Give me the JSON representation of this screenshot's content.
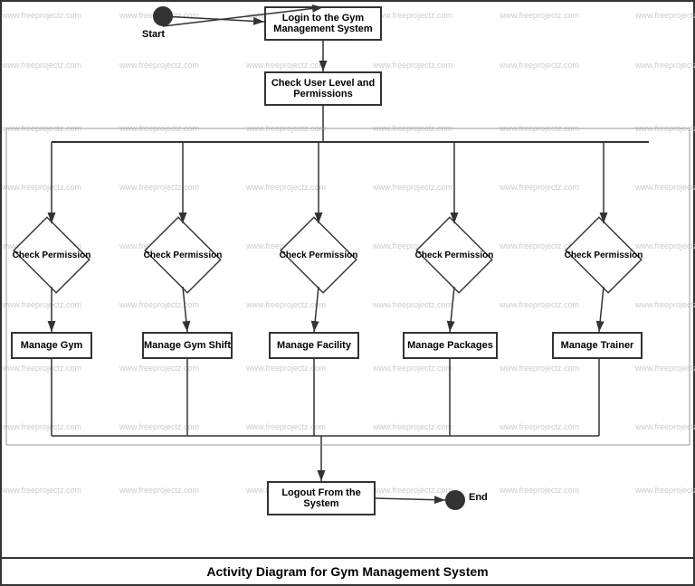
{
  "diagram": {
    "title": "Activity Diagram for Gym Management System",
    "nodes": {
      "start_label": "Start",
      "end_label": "End",
      "login": "Login to the Gym Management System",
      "check_user_level": "Check User Level and Permissions",
      "check_perm1": "Check Permission",
      "check_perm2": "Check Permission",
      "check_perm3": "Check Permission",
      "check_perm4": "Check Permission",
      "check_perm5": "Check Permission",
      "manage_gym": "Manage Gym",
      "manage_gym_shift": "Manage Gym Shift",
      "manage_facility": "Manage Facility",
      "manage_packages": "Manage Packages",
      "manage_trainer": "Manage Trainer",
      "logout": "Logout From the System"
    },
    "watermarks": [
      "www.freeprojectz.com"
    ]
  }
}
